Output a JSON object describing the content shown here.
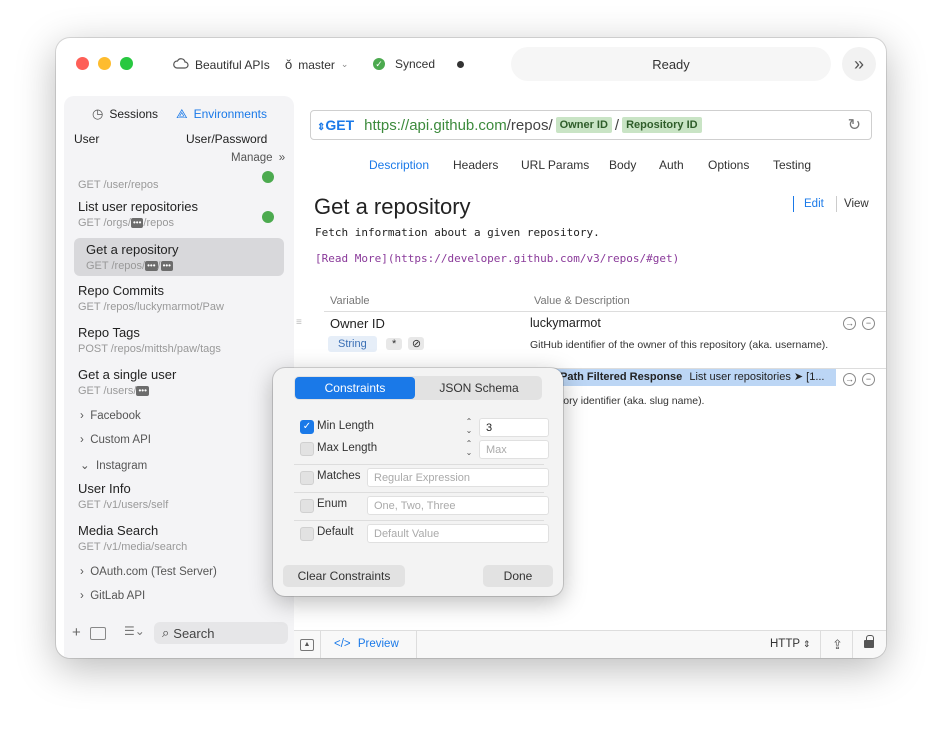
{
  "titlebar": {
    "project": "Beautiful APIs",
    "branch": "master",
    "sync_status": "Synced",
    "status": "Ready"
  },
  "sidebar": {
    "tabs": [
      "Sessions",
      "Environments"
    ],
    "env_user_label": "User",
    "env_value": "User/Password",
    "manage_label": "Manage",
    "requests": [
      {
        "title": "",
        "url": "GET /user/repos"
      },
      {
        "title": "List user repositories",
        "url": "GET /orgs/⋯/repos"
      },
      {
        "title": "Get a repository",
        "url": "GET /repos/⋯/⋯"
      },
      {
        "title": "Repo Commits",
        "url": "GET /repos/luckymarmot/Paw"
      },
      {
        "title": "Repo Tags",
        "url": "POST /repos/mittsh/paw/tags"
      },
      {
        "title": "Get a single user",
        "url": "GET /users/⋯"
      }
    ],
    "groups": {
      "facebook": "Facebook",
      "custom_api": "Custom API",
      "instagram": "Instagram"
    },
    "instagram_requests": [
      {
        "title": "User Info",
        "url": "GET /v1/users/self"
      },
      {
        "title": "Media Search",
        "url": "GET /v1/media/search"
      }
    ],
    "groups_after": [
      "OAuth.com (Test Server)",
      "GitLab API"
    ],
    "search_placeholder": "Search"
  },
  "url_bar": {
    "method": "GET",
    "scheme": "https://",
    "host": "api.github.com",
    "path": "/repos/",
    "token1": "Owner ID",
    "sep": "/",
    "token2": "Repository ID"
  },
  "tabs": [
    "Description",
    "Headers",
    "URL Params",
    "Body",
    "Auth",
    "Options",
    "Testing"
  ],
  "description": {
    "title": "Get a repository",
    "edit": "Edit",
    "view": "View",
    "text": "Fetch information about a given repository.",
    "link": "[Read More](https://developer.github.com/v3/repos/#get)"
  },
  "params_table": {
    "col_variable": "Variable",
    "col_value": "Value & Description",
    "rows": [
      {
        "name": "Owner ID",
        "type": "String",
        "value": "luckymarmot",
        "desc": "GitHub identifier of the owner of this repository (aka. username)."
      },
      {
        "name": "",
        "value_prefix": "Path Filtered Response",
        "value": "List user repositories ➤ [1...",
        "desc": "itory identifier (aka. slug name)."
      }
    ]
  },
  "popover": {
    "seg_constraints": "Constraints",
    "seg_json_schema": "JSON Schema",
    "min_length_label": "Min Length",
    "min_length_value": "3",
    "max_length_label": "Max Length",
    "max_placeholder": "Max",
    "matches_label": "Matches",
    "matches_placeholder": "Regular Expression",
    "enum_label": "Enum",
    "enum_placeholder": "One, Two, Three",
    "default_label": "Default",
    "default_placeholder": "Default Value",
    "clear_button": "Clear Constraints",
    "done_button": "Done"
  },
  "bottom": {
    "preview": "Preview",
    "http_label": "HTTP"
  },
  "colors": {
    "accent": "#1a79e8",
    "token_bg": "#c9e4c5",
    "status_green": "#4caa4f"
  }
}
